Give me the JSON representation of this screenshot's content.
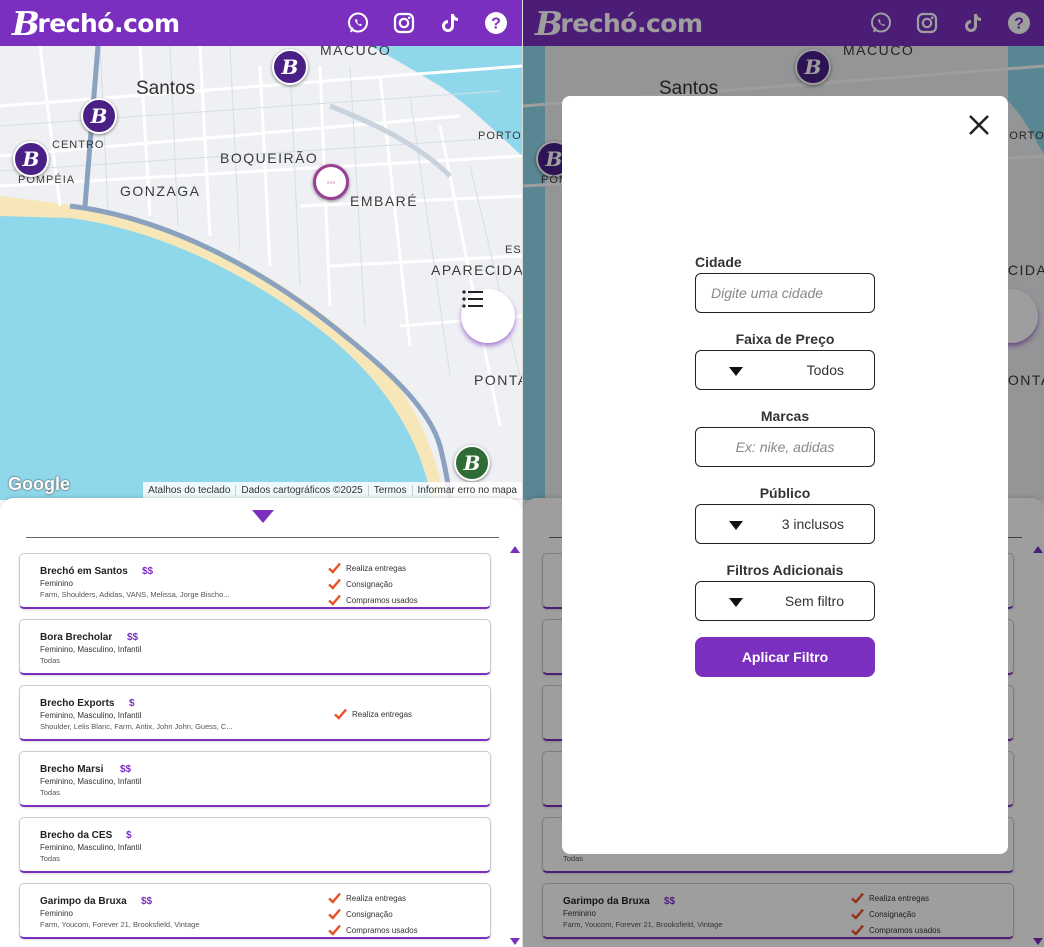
{
  "header": {
    "logo_initial": "B",
    "logo_text": "rechó.com",
    "icons": [
      "whatsapp-icon",
      "instagram-icon",
      "tiktok-icon",
      "help-icon"
    ]
  },
  "map": {
    "labels": {
      "santos": "Santos",
      "macuco": "MACUCO",
      "centro": "CENTRO",
      "pompeia": "POMPÉIA",
      "boqueirao": "BOQUEIRÃO",
      "gonzaga": "GONZAGA",
      "embare": "EMBARÉ",
      "aparecida": "APARECIDA",
      "ponta": "PONTA",
      "porto": "PORTO N",
      "est": "ES"
    },
    "google_logo": "Google",
    "attribution": {
      "shortcuts": "Atalhos do teclado",
      "data": "Dados cartográficos ©2025",
      "terms": "Termos",
      "report": "Informar erro no mapa"
    }
  },
  "stores": [
    {
      "name": "Brechó em Santos",
      "price": "$$",
      "public": "Feminino",
      "brands": "Farm, Shoulders, Adidas, VANS, Melissa, Jorge Bischo...",
      "features": [
        "Realiza entregas",
        "Consignação",
        "Compramos usados"
      ]
    },
    {
      "name": "Bora Brecholar",
      "price": "$$",
      "public": "Feminino, Masculino, Infantil",
      "brands": "Todas",
      "features": []
    },
    {
      "name": "Brecho Exports",
      "price": "$",
      "public": "Feminino, Masculino, Infantil",
      "brands": "Shoulder, Lelis Blanc, Farm, Antix, John John, Guess, C...",
      "features": [
        "Realiza entregas"
      ]
    },
    {
      "name": "Brecho Marsi",
      "price": "$$",
      "public": "Feminino, Masculino, Infantil",
      "brands": "Todas",
      "features": []
    },
    {
      "name": "Brecho da CES",
      "price": "$",
      "public": "Feminino, Masculino, Infantil",
      "brands": "Todas",
      "features": []
    },
    {
      "name": "Garimpo da Bruxa",
      "price": "$$",
      "public": "Feminino",
      "brands": "Farm, Youcom, Forever 21, Brooksfield, Vintage",
      "features": [
        "Realiza entregas",
        "Consignação",
        "Compramos usados"
      ]
    }
  ],
  "filter_modal": {
    "city_label": "Cidade",
    "city_placeholder": "Digite uma cidade",
    "price_label": "Faixa de Preço",
    "price_value": "Todos",
    "brands_label": "Marcas",
    "brands_placeholder": "Ex: nike, adidas",
    "public_label": "Público",
    "public_value": "3 inclusos",
    "extra_label": "Filtros Adicionais",
    "extra_value": "Sem filtro",
    "apply_label": "Aplicar Filtro"
  },
  "colors": {
    "brand": "#7b2fbe",
    "check": "#e8502a",
    "ocean": "#8fd8ec"
  }
}
